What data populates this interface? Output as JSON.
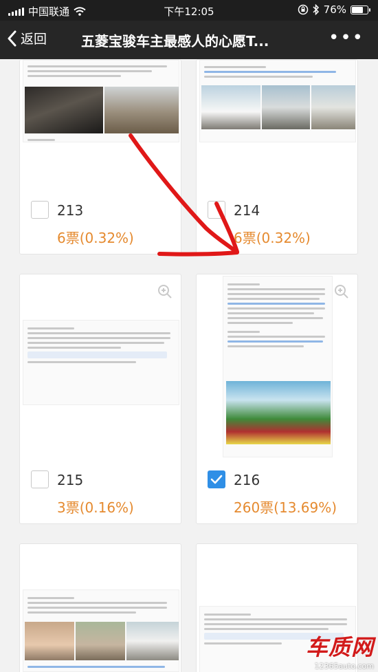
{
  "status_bar": {
    "carrier": "中国联通",
    "time": "下午12:05",
    "battery": "76%",
    "battery_level": 0.76
  },
  "nav": {
    "back_label": "返回",
    "title": "五菱宝骏车主最感人的心愿T..."
  },
  "candidates": [
    {
      "number": "213",
      "votes": "6票(0.32%)",
      "checked": false
    },
    {
      "number": "214",
      "votes": "6票(0.32%)",
      "checked": false
    },
    {
      "number": "215",
      "votes": "3票(0.16%)",
      "checked": false
    },
    {
      "number": "216",
      "votes": "260票(13.69%)",
      "checked": true
    }
  ],
  "watermark": {
    "logo": "车质网",
    "url": "12365auto.com"
  },
  "colors": {
    "vote_orange": "#e58a2f",
    "check_blue": "#2f8fe6",
    "nav_bg": "#262626",
    "arrow_red": "#e01818"
  }
}
